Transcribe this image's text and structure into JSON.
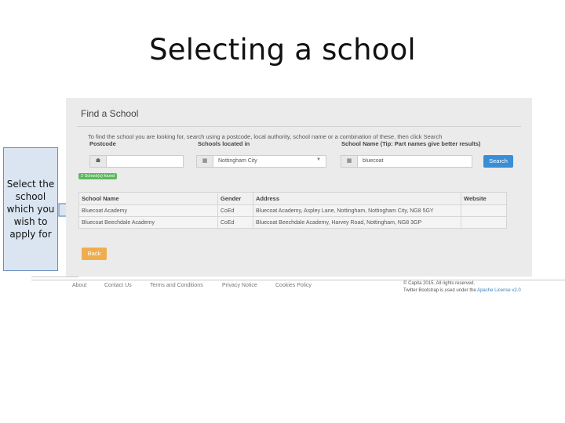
{
  "slide": {
    "title": "Selecting a school"
  },
  "callout": {
    "text": "Select the school which you wish to apply for"
  },
  "panel": {
    "title": "Find a School",
    "instructions": "To find the school you are looking for, search using a postcode, local authority, school name or a combination of these, then click Search",
    "labels": {
      "postcode": "Postcode",
      "located_in": "Schools located in",
      "school_name": "School Name (Tip: Part names give better results)"
    },
    "postcode_value": "",
    "located_in_value": "Nottingham City",
    "school_name_value": "bluecoat",
    "search_label": "Search",
    "badge": "2 School(s) found",
    "table": {
      "headers": [
        "School Name",
        "Gender",
        "Address",
        "Website"
      ],
      "rows": [
        [
          "Bluecoat Academy",
          "CoEd",
          "Bluecoat Academy, Aspley Lane, Nottingham, Nottingham City, NG8 5GY",
          ""
        ],
        [
          "Bluecoat Beechdale Academy",
          "CoEd",
          "Bluecoat Beechdale Academy, Harvey Road, Nottingham, NG8 3GP",
          ""
        ]
      ]
    },
    "back_label": "Back"
  },
  "footer": {
    "links": [
      "About",
      "Contact Us",
      "Terms and Conditions",
      "Privacy Notice",
      "Cookies Policy"
    ],
    "copyright": "© Capita 2015. All rights reserved.",
    "license_prefix": "Twitter Bootstrap is used under the ",
    "license_link": "Apache License v2.0"
  },
  "colors": {
    "primary": "#3a8ed6",
    "back_button": "#f0ad4e",
    "badge": "#5cb85c",
    "callout_fill": "#dbe5f1",
    "callout_border": "#6b8fbf"
  }
}
